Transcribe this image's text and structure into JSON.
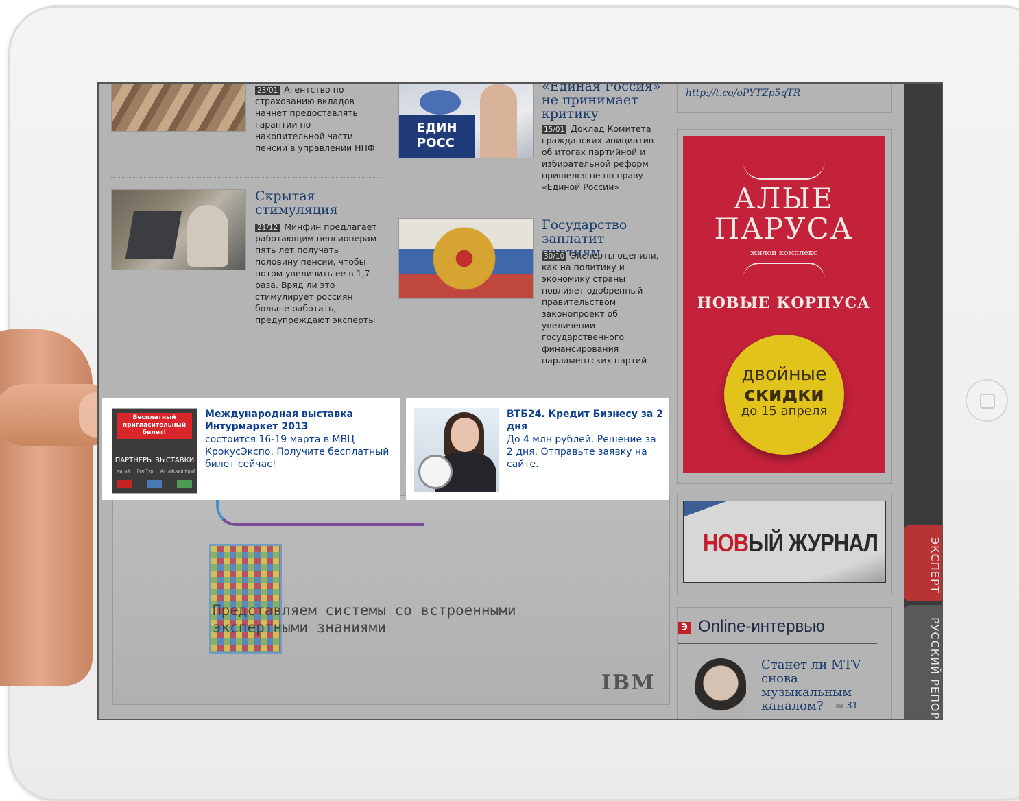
{
  "articles": [
    {
      "date": "23/01",
      "text": "Агентство по страхованию вкладов начнет предоставлять гарантии по накопительной части пенсии в управлении НПФ"
    },
    {
      "title": "«Единая Россия» не принимает критику",
      "date": "15/01",
      "text": "Доклад Комитета гражданских инициатив об итогах партийной и избирательной реформ пришелся не по нраву «Единой России»"
    },
    {
      "title": "Скрытая стимуляция",
      "date": "21/12",
      "text": "Минфин предлагает работающим пенсионерам пять лет получать половину пенсии, чтобы потом увеличить ее в 1,7 раза. Вряд ли это стимулирует россиян больше работать, предупреждают эксперты"
    },
    {
      "title": "Государство заплатит партиям",
      "date": "30/10",
      "text": "Эксперты оценили, как на политику и экономику страны повлияет одобренный правительством законопроект об увеличении государственного финансирования парламентских партий"
    }
  ],
  "thumb_labels": {
    "party_sign_top": "ЕДИН",
    "party_sign_bottom": "РОСС"
  },
  "tweet_link": "http://t.co/oPYTZp5qTR",
  "ads": [
    {
      "title": "Международная выставка Интурмаркет 2013",
      "text": "состоится 16-19 марта в МВЦ КрокусЭкспо. Получите бесплатный билет сейчас!",
      "image_top": "Бесплатный пригласительный билет!",
      "image_bottom": "ПАРТНЕРЫ ВЫСТАВКИ",
      "image_countries": [
        "Китай",
        "Гео Тур",
        "Алтайский Край"
      ]
    },
    {
      "title": "ВТБ24. Кредит Бизнесу за 2 дня",
      "text": "До 4 млн рублей. Решение за 2 дня. Отправьте заявку на сайте."
    }
  ],
  "banner_red": {
    "brand_line1": "АЛЫЕ",
    "brand_line2": "ПАРУСА",
    "subtitle": "жилой комплекс",
    "headline": "НОВЫЕ КОРПУСА",
    "circle_line1": "двойные",
    "circle_line2": "скидки",
    "circle_line3": "до 15 апреля",
    "color": "#c8213c",
    "circle_color": "#e8cc1b"
  },
  "banner_journal": {
    "part1": "НОВ",
    "part2": "ЫЙ ЖУРНАЛ"
  },
  "ibm_ad": {
    "text": "Представляем системы со встроенными экспертными знаниями",
    "logo": "IBM"
  },
  "online": {
    "icon": "Э",
    "title": "Online-интервью",
    "question": "Станет ли MTV снова музыкальным каналом?",
    "comments": "31"
  },
  "side_tabs": [
    {
      "label": "ЭКСПЕРТ",
      "color": "#c23b3b"
    },
    {
      "label": "РУССКИЙ РЕПОР",
      "color": "#5a5a5a"
    }
  ]
}
